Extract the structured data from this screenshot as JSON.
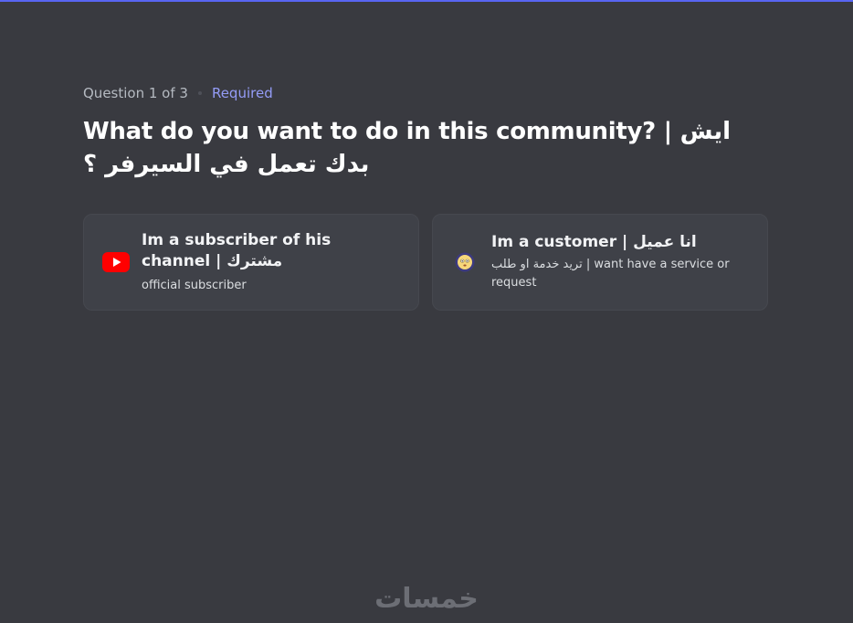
{
  "header": {
    "progress": "Question 1 of 3",
    "required": "Required",
    "accent_color": "#5865f2"
  },
  "question": {
    "text": "What do you want to do in this community? | ايش بدك تعمل في السيرفر ؟"
  },
  "options": [
    {
      "icon": "youtube-icon",
      "title": "Im a subscriber of his channel | مشترك",
      "description": "official subscriber"
    },
    {
      "icon": "smiley-face-icon",
      "title": "Im a customer | انا عميل",
      "description": "تريد خدمة او طلب | want have a service or request"
    }
  ],
  "watermark": {
    "text": "خمسات"
  }
}
